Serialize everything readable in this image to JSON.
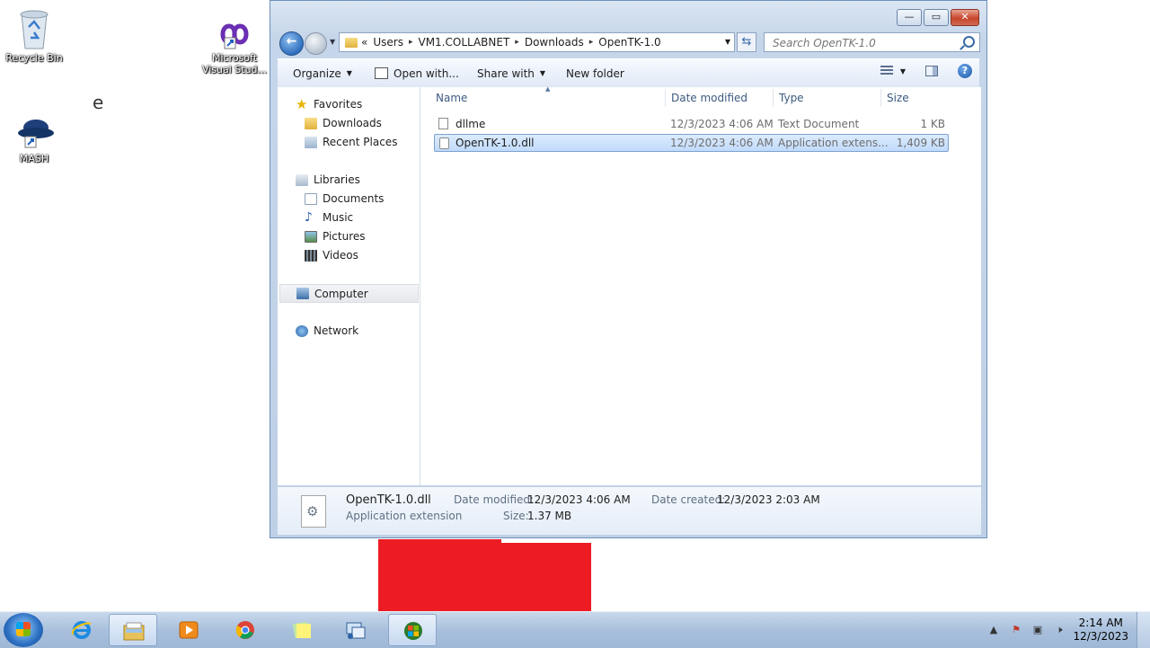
{
  "desktop": {
    "icons": [
      {
        "label": "Recycle Bin"
      },
      {
        "label": "Microsoft Visual Stud..."
      },
      {
        "label": "MASH"
      }
    ],
    "stray_text": "e"
  },
  "window": {
    "caption_buttons": {
      "minimize": "—",
      "maximize": "▭",
      "close": "✕"
    },
    "address": {
      "overflow": "«",
      "crumbs": [
        "Users",
        "VM1.COLLABNET",
        "Downloads",
        "OpenTK-1.0"
      ],
      "separator": "▸"
    },
    "search": {
      "placeholder": "Search OpenTK-1.0"
    },
    "toolbar": {
      "organize": "Organize",
      "open_with": "Open with...",
      "share_with": "Share with",
      "new_folder": "New folder",
      "help": "?"
    },
    "nav": {
      "favorites": "Favorites",
      "downloads": "Downloads",
      "recent_places": "Recent Places",
      "libraries": "Libraries",
      "documents": "Documents",
      "music": "Music",
      "pictures": "Pictures",
      "videos": "Videos",
      "computer": "Computer",
      "network": "Network"
    },
    "columns": {
      "name": "Name",
      "date": "Date modified",
      "type": "Type",
      "size": "Size"
    },
    "files": [
      {
        "name": "dllme",
        "date": "12/3/2023 4:06 AM",
        "type": "Text Document",
        "size": "1 KB",
        "selected": false
      },
      {
        "name": "OpenTK-1.0.dll",
        "date": "12/3/2023 4:06 AM",
        "type": "Application extens...",
        "size": "1,409 KB",
        "selected": true
      }
    ],
    "details": {
      "filename": "OpenTK-1.0.dll",
      "filetype": "Application extension",
      "date_modified_label": "Date modified:",
      "date_modified": "12/3/2023 4:06 AM",
      "size_label": "Size:",
      "size": "1.37 MB",
      "date_created_label": "Date created:",
      "date_created": "12/3/2023 2:03 AM"
    }
  },
  "taskbar": {
    "time": "2:14 AM",
    "date": "12/3/2023",
    "apps": [
      "internet-explorer",
      "windows-explorer",
      "media-player",
      "chrome",
      "sticky-notes",
      "network-app",
      "windows-app"
    ]
  },
  "colors": {
    "accent": "#2f6fbf",
    "selection": "#c1dbfc",
    "red_block": "#ed1c24"
  }
}
